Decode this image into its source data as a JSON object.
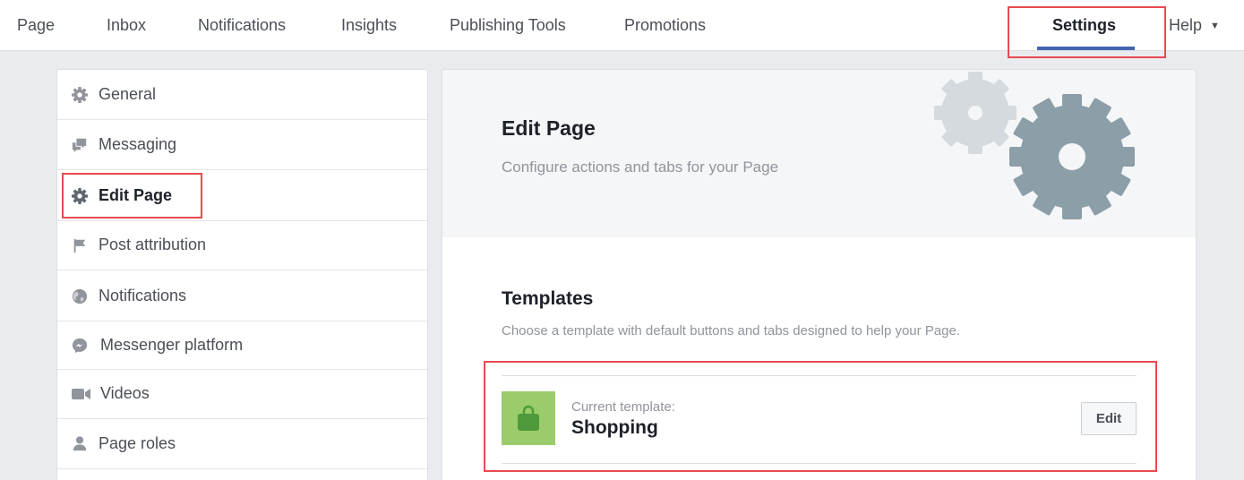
{
  "topnav": {
    "items": [
      {
        "label": "Page"
      },
      {
        "label": "Inbox"
      },
      {
        "label": "Notifications"
      },
      {
        "label": "Insights"
      },
      {
        "label": "Publishing Tools"
      },
      {
        "label": "Promotions"
      },
      {
        "label": "Settings"
      },
      {
        "label": "Help"
      }
    ],
    "active": "Settings"
  },
  "sidebar": {
    "items": [
      {
        "label": "General",
        "icon": "gear-icon"
      },
      {
        "label": "Messaging",
        "icon": "chat-bubbles-icon"
      },
      {
        "label": "Edit Page",
        "icon": "gear-icon"
      },
      {
        "label": "Post attribution",
        "icon": "flag-icon"
      },
      {
        "label": "Notifications",
        "icon": "globe-icon"
      },
      {
        "label": "Messenger platform",
        "icon": "messenger-icon"
      },
      {
        "label": "Videos",
        "icon": "video-camera-icon"
      },
      {
        "label": "Page roles",
        "icon": "person-icon"
      }
    ],
    "active": "Edit Page"
  },
  "main": {
    "title": "Edit Page",
    "subtitle": "Configure actions and tabs for your Page",
    "templates": {
      "title": "Templates",
      "description": "Choose a template with default buttons and tabs designed to help your Page.",
      "current_caption": "Current template:",
      "current_name": "Shopping",
      "thumb_icon": "shopping-bag-icon",
      "edit_label": "Edit"
    }
  },
  "colors": {
    "accent": "#4267b2",
    "highlight": "#e84a4f",
    "template_thumb": "#9bcc6b"
  }
}
